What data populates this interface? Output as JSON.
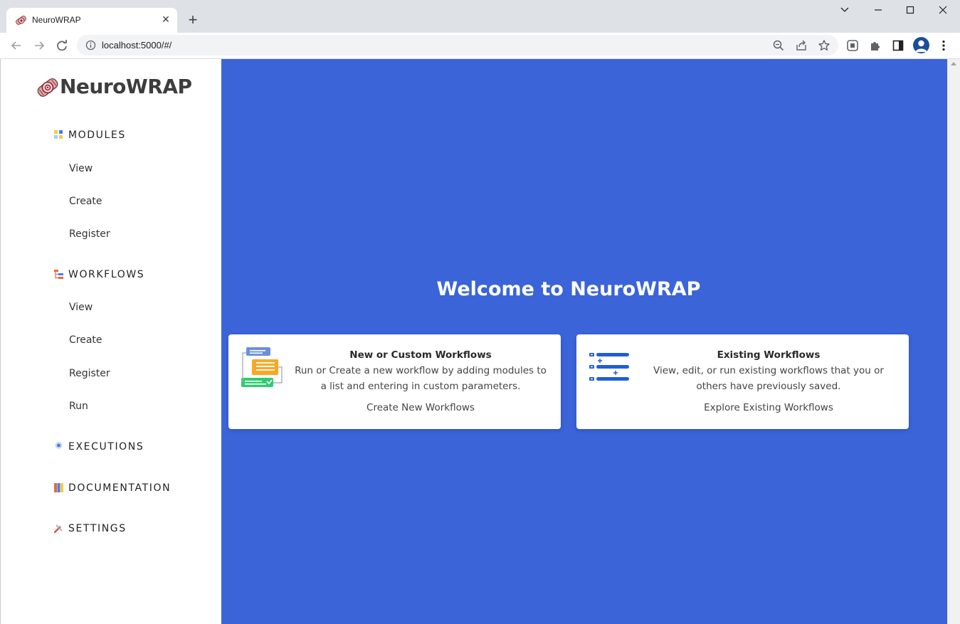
{
  "browser": {
    "tab_title": "NeuroWRAP",
    "tab_close": "✕",
    "new_tab": "+",
    "url": "localhost:5000/#/"
  },
  "sidebar": {
    "brand": "NeuroWRAP",
    "sections": [
      {
        "label": "MODULES",
        "icon": "modules-icon",
        "items": [
          "View",
          "Create",
          "Register"
        ]
      },
      {
        "label": "WORKFLOWS",
        "icon": "workflows-icon",
        "items": [
          "View",
          "Create",
          "Register",
          "Run"
        ]
      },
      {
        "label": "EXECUTIONS",
        "icon": "executions-icon",
        "items": []
      },
      {
        "label": "DOCUMENTATION",
        "icon": "documentation-icon",
        "items": []
      },
      {
        "label": "SETTINGS",
        "icon": "settings-icon",
        "items": []
      }
    ]
  },
  "main": {
    "welcome": "Welcome to NeuroWRAP",
    "cards": [
      {
        "title": "New or Custom Workflows",
        "description": "Run or Create a new workflow by adding modules to a list and entering in custom parameters.",
        "link": "Create New Workflows",
        "icon": "custom-workflow-illustration"
      },
      {
        "title": "Existing Workflows",
        "description": "View, edit, or run existing workflows that you or others have previously saved.",
        "link": "Explore Existing Workflows",
        "icon": "workflow-list-illustration"
      }
    ]
  },
  "colors": {
    "main_background": "#3b64d9",
    "card_background": "#ffffff",
    "chrome_background": "#dee1e6"
  }
}
